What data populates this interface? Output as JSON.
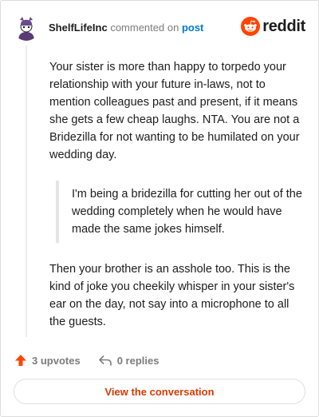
{
  "comment": {
    "username": "ShelfLifeInc",
    "action_text": "commented on",
    "post_link": "post",
    "brand": "reddit",
    "paragraph_1": "Your sister is more than happy to torpedo your relationship with your future in-laws, not to mention colleagues past and present, if it means she gets a few cheap laughs. NTA. You are not a Bridezilla for not wanting to be humilated on your wedding day.",
    "quote": "I'm being a bridezilla for cutting her out of the wedding completely when he would have made the same jokes himself.",
    "paragraph_2": "Then your brother is an asshole too. This is the kind of joke you cheekily whisper in your sister's ear on the day, not say into a microphone to all the guests."
  },
  "footer": {
    "upvotes": "3 upvotes",
    "replies": "0 replies",
    "view_button": "View the conversation"
  },
  "icons": {
    "avatar": "avatar-icon",
    "logo": "reddit-snoo-icon",
    "upvote": "upvote-arrow-icon",
    "reply": "reply-arrow-icon"
  },
  "colors": {
    "brand_orange": "#ff4500",
    "button_text": "#d93a00",
    "link_blue": "#0079d3"
  }
}
